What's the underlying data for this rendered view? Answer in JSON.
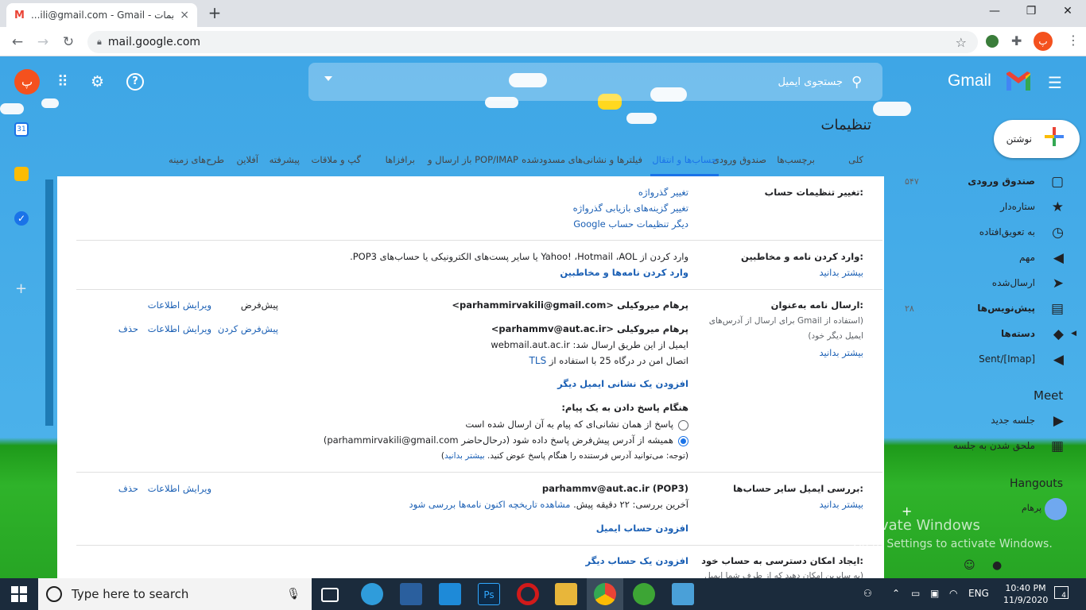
{
  "browser": {
    "tab_title": "‎‎...ili@gmail.com - Gmail - تنظیمات",
    "new_tab": "+",
    "close_tab": "×",
    "minimize": "—",
    "maximize": "❐",
    "close_window": "✕",
    "url": "mail.google.com",
    "profile_letter": "پ"
  },
  "gmail": {
    "logo_text": "Gmail",
    "search_placeholder": "جستجوی ایمیل",
    "avatar_letter": "پ",
    "page_title": "تنظیمات",
    "compose_label": "نوشتن",
    "settings_tabs": [
      {
        "label": "کلی"
      },
      {
        "label": "برچسب‌ها"
      },
      {
        "label": "صندوق ورودی"
      },
      {
        "label": "حساب‌ها و انتقال",
        "active": true
      },
      {
        "label": "فیلترها و نشانی‌های مسدودشده"
      },
      {
        "label": "باز ارسال و POP/IMAP"
      },
      {
        "label": "برافزاها"
      },
      {
        "label": "گپ و ملاقات"
      },
      {
        "label": "پیشرفته"
      },
      {
        "label": "آفلاین"
      },
      {
        "label": "طرح‌های زمینه"
      }
    ]
  },
  "sidebar": {
    "items": [
      {
        "label": "صندوق ورودی",
        "count": "۵۴۷",
        "icon": "inbox-icon",
        "bold": true
      },
      {
        "label": "ستاره‌دار",
        "count": "",
        "icon": "star-icon"
      },
      {
        "label": "به تعویق‌افتاده",
        "count": "",
        "icon": "clock-icon"
      },
      {
        "label": "مهم",
        "count": "",
        "icon": "important-icon"
      },
      {
        "label": "ارسال‌شده",
        "count": "",
        "icon": "send-icon"
      },
      {
        "label": "پیش‌نویس‌ها",
        "count": "۲۸",
        "icon": "draft-icon",
        "bold": true
      },
      {
        "label": "دسته‌ها",
        "count": "",
        "icon": "category-icon",
        "bold": true
      },
      {
        "label": "Sent/[Imap]",
        "count": "",
        "icon": "label-icon"
      }
    ],
    "meet_heading": "Meet",
    "meet_new": "جلسه جدید",
    "meet_join": "ملحق شدن به جلسه",
    "hangouts_heading": "Hangouts",
    "hangouts_user": "پرهام"
  },
  "settings": {
    "change_account": {
      "label": "تغییر تنظیمات حساب:",
      "links": [
        "تغییر گذرواژه",
        "تغییر گزینه‌های بازیابی گذرواژه",
        "دیگر تنظیمات حساب Google"
      ]
    },
    "import": {
      "label": "وارد کردن نامه و مخاطبین:",
      "learn_more": "بیشتر بدانید",
      "desc": "وارد کردن از Yahoo! ،Hotmail ،AOL یا سایر پست‌های الکترونیکی یا حساب‌های POP3.",
      "action": "وارد کردن نامه‌ها و مخاطبین"
    },
    "send_as": {
      "label": "ارسال نامه به‌عنوان:",
      "sub": "(استفاده از Gmail برای ارسال از آدرس‌های ایمیل دیگر خود)",
      "learn_more": "بیشتر بدانید",
      "addr1": "پرهام میروکیلی <parhammirvakili@gmail.com>",
      "addr1_default": "پیش‌فرض",
      "addr1_edit": "ویرایش اطلاعات",
      "addr2": "پرهام میروکیلی <parhammv@aut.ac.ir>",
      "addr2_via": "ایمیل از این طریق ارسال شد: webmail.aut.ac.ir",
      "addr2_tls_text": "اتصال امن در درگاه 25 با استفاده از",
      "addr2_tls": "TLS",
      "addr2_make_default": "پیش‌فرض کردن",
      "addr2_edit": "ویرایش اطلاعات",
      "addr2_delete": "حذف",
      "add_address": "افزودن یک نشانی ایمیل دیگر",
      "reply_heading": "هنگام پاسخ دادن به یک پیام:",
      "reply_opt1": "پاسخ از همان نشانی‌ای که پیام به آن ارسال شده است",
      "reply_opt2": "همیشه از آدرس پیش‌فرض پاسخ داده شود (درحال‌حاضر parhammirvakili@gmail.com)",
      "reply_note": "(توجه: می‌توانید آدرس فرستنده را هنگام پاسخ عوض کنید.",
      "reply_note_link": "بیشتر بدانید",
      "reply_note_end": ")"
    },
    "check_mail": {
      "label": "بررسی ایمیل سایر حساب‌ها:",
      "learn_more": "بیشتر بدانید",
      "account": "parhammv@aut.ac.ir (POP3)",
      "last_check": "آخرین بررسی: ۲۲ دقیقه پیش.",
      "history": "مشاهده تاریخچه",
      "check_now": "اکنون نامه‌ها بررسی شود",
      "edit": "ویرایش اطلاعات",
      "delete": "حذف",
      "add": "افزودن حساب ایمیل"
    },
    "grant_access": {
      "label": "ایجاد امکان دسترسی به حساب خود:",
      "action": "افزودن یک حساب دیگر",
      "partial": "(به سایرین امکان دهید که از طرف شما ایمیل"
    }
  },
  "watermark": {
    "line1": "Activate Windows",
    "line2": "Go to Settings to activate Windows."
  },
  "taskbar": {
    "search_placeholder": "Type here to search",
    "language": "ENG",
    "time": "10:40 PM",
    "date": "11/9/2020",
    "notifications": "4"
  }
}
